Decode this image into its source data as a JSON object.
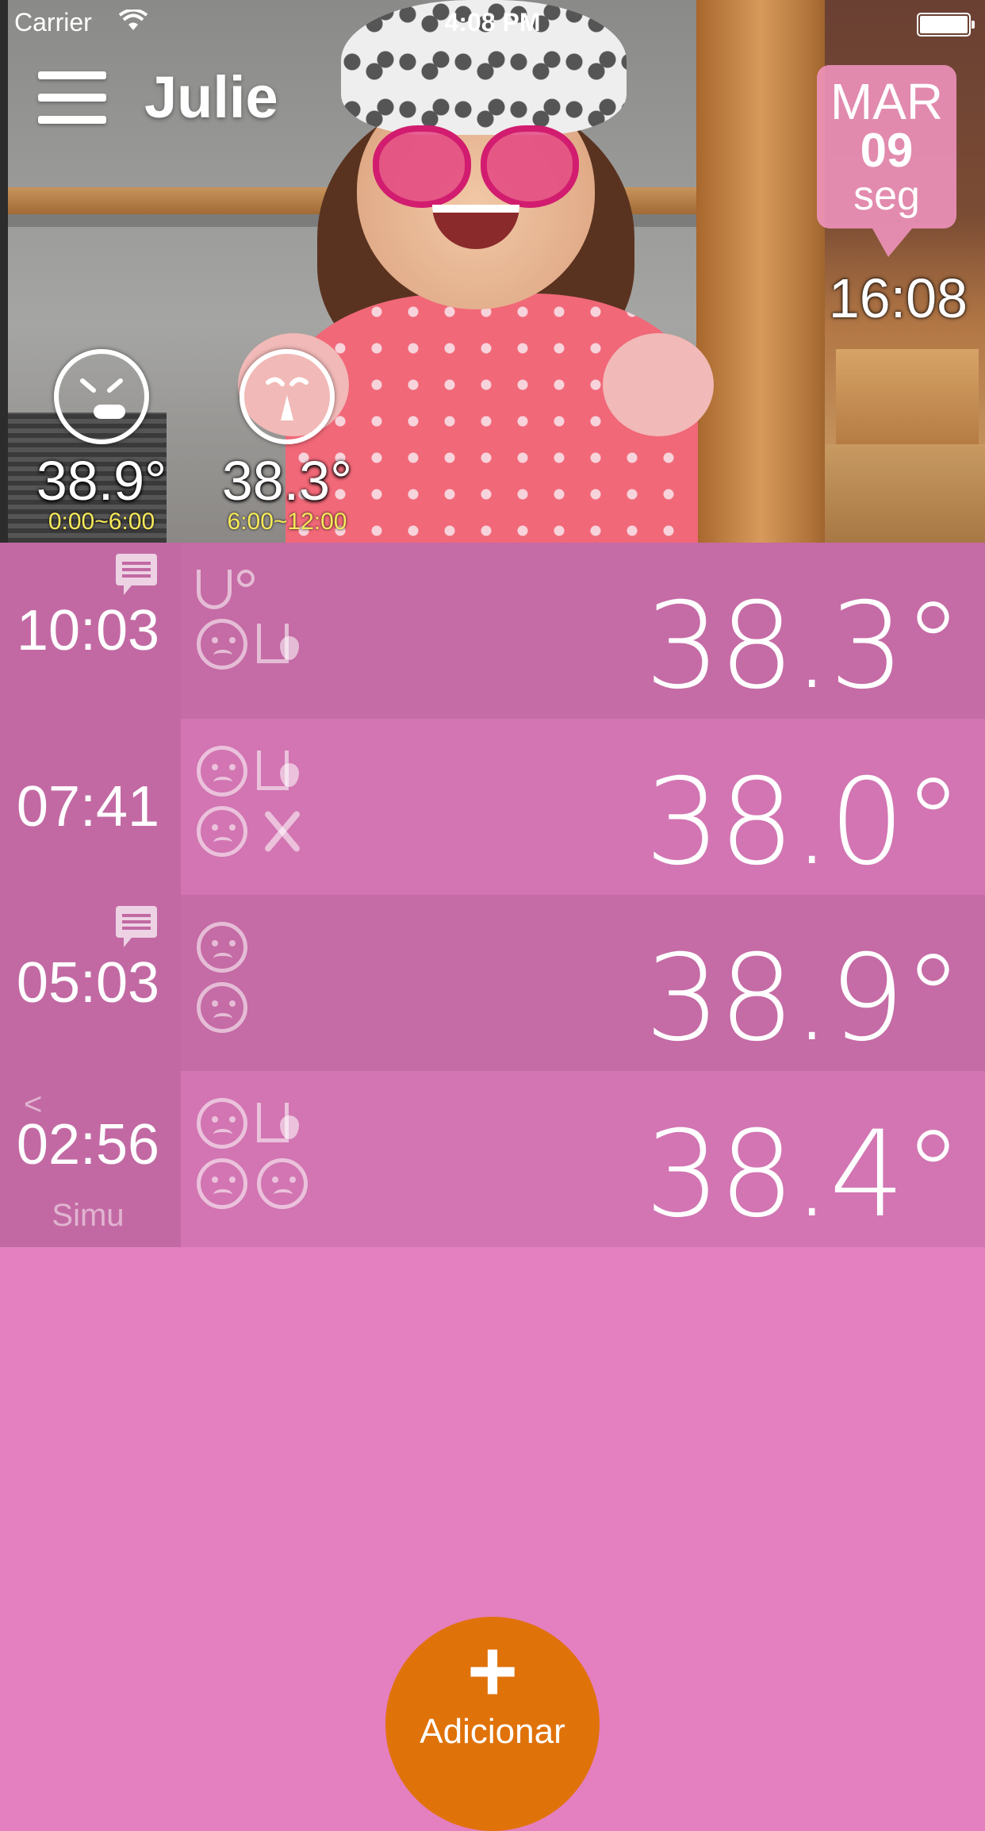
{
  "status_bar": {
    "carrier": "Carrier",
    "time": "4:08 PM"
  },
  "header": {
    "child_name": "Julie",
    "date": {
      "month": "MAR",
      "day": "09",
      "weekday": "seg"
    },
    "clock": "16:08",
    "summaries": [
      {
        "temp": "38.9°",
        "range": "0:00~6:00",
        "face": "coughing-face-icon"
      },
      {
        "temp": "38.3°",
        "range": "6:00~12:00",
        "face": "runny-nose-face-icon"
      }
    ]
  },
  "records": [
    {
      "time": "10:03",
      "reading": "38.3°",
      "has_note": true,
      "shared": false,
      "author": "",
      "icons": [
        "stethoscope-icon",
        "runny-nose-face-icon",
        "drink-icon"
      ],
      "shade": "#c56ba5",
      "bodyshade": "#c56ba5"
    },
    {
      "time": "07:41",
      "reading": "38.0°",
      "has_note": false,
      "shared": false,
      "author": "",
      "icons": [
        "coughing-face-icon",
        "drink-icon",
        "runny-nose-face-icon",
        "meal-icon"
      ],
      "shade": "#c56ba5",
      "bodyshade": "#d275b2"
    },
    {
      "time": "05:03",
      "reading": "38.9°",
      "has_note": true,
      "shared": false,
      "author": "",
      "icons": [
        "sad-face-icon",
        "coughing-face-icon"
      ],
      "shade": "#c56ba5",
      "bodyshade": "#c56ba5"
    },
    {
      "time": "02:56",
      "reading": "38.4°",
      "has_note": false,
      "shared": true,
      "author": "Simu",
      "icons": [
        "coughing-face-icon",
        "drink-icon",
        "runny-nose-face-icon",
        "sleepy-face-icon"
      ],
      "shade": "#c56ba5",
      "bodyshade": "#d275b2"
    }
  ],
  "add_button": {
    "label": "Adicionar"
  },
  "colors": {
    "background": "#e47fc0",
    "time_column": "#c269a3",
    "accent": "#e0720a"
  }
}
